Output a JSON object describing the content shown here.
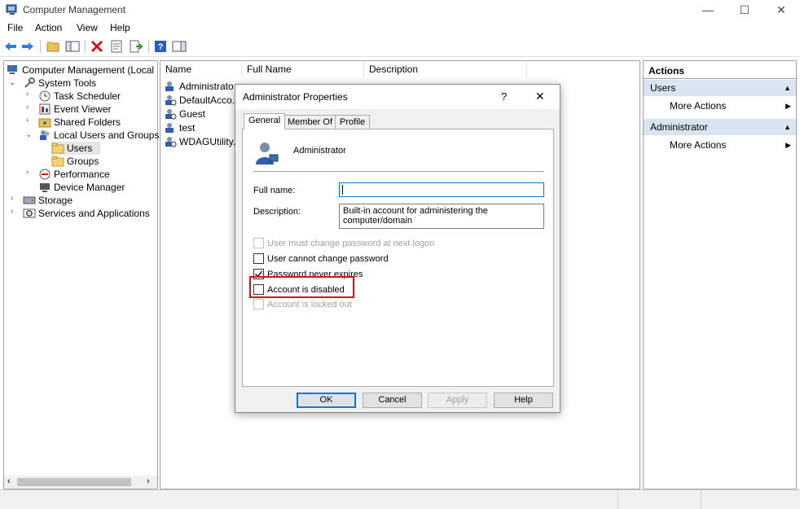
{
  "window": {
    "title": "Computer Management",
    "controls": {
      "minimize": "—",
      "maximize": "☐",
      "close": "✕"
    }
  },
  "menu": [
    "File",
    "Action",
    "View",
    "Help"
  ],
  "tree": {
    "root": "Computer Management (Local",
    "system_tools": "System Tools",
    "task_scheduler": "Task Scheduler",
    "event_viewer": "Event Viewer",
    "shared_folders": "Shared Folders",
    "local_users_groups": "Local Users and Groups",
    "users": "Users",
    "groups": "Groups",
    "performance": "Performance",
    "device_manager": "Device Manager",
    "storage": "Storage",
    "services_apps": "Services and Applications"
  },
  "list": {
    "columns": [
      "Name",
      "Full Name",
      "Description"
    ],
    "rows": [
      "Administrato",
      "DefaultAcco...",
      "Guest",
      "test",
      "WDAGUtility..."
    ]
  },
  "actions": {
    "header": "Actions",
    "group1": "Users",
    "more1": "More Actions",
    "group2": "Administrator",
    "more2": "More Actions"
  },
  "dialog": {
    "title": "Administrator Properties",
    "help": "?",
    "close": "✕",
    "tabs": [
      "General",
      "Member Of",
      "Profile"
    ],
    "account_name": "Administrator",
    "full_name_label": "Full name:",
    "full_name_value": "",
    "description_label": "Description:",
    "description_value": "Built-in account for administering the computer/domain",
    "checkboxes": {
      "must_change": "User must change password at next logon",
      "cannot_change": "User cannot change password",
      "never_expires": "Password never expires",
      "disabled": "Account is disabled",
      "locked_out": "Account is locked out"
    },
    "buttons": {
      "ok": "OK",
      "cancel": "Cancel",
      "apply": "Apply",
      "help": "Help"
    }
  },
  "colors": {
    "selection": "#0078d7",
    "highlight": "#d0141c",
    "actions_group_bg": "#d9e4f1"
  }
}
